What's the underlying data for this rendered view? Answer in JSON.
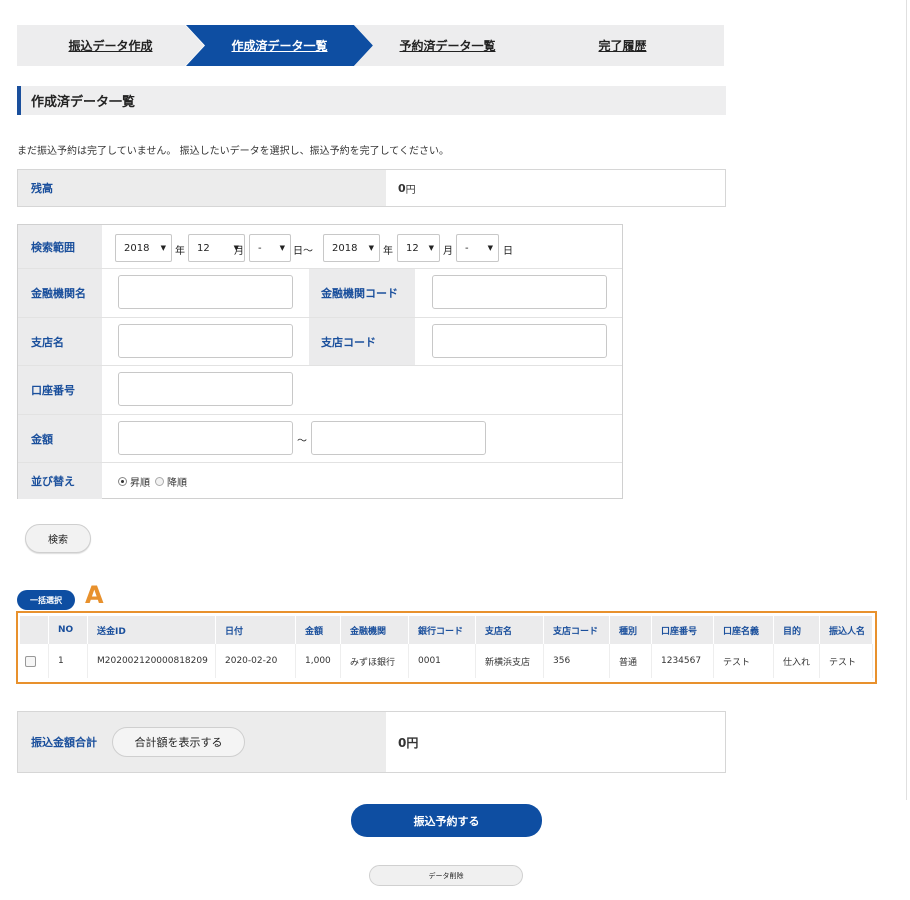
{
  "steps": [
    {
      "label": "振込データ作成",
      "active": false
    },
    {
      "label": "作成済データ一覧",
      "active": true
    },
    {
      "label": "予約済データ一覧",
      "active": false
    },
    {
      "label": "完了履歴",
      "active": false
    }
  ],
  "colors": {
    "primary": "#0e4ea2",
    "highlight": "#e8912d",
    "label_bg": "#ececec"
  },
  "section_title": "作成済データ一覧",
  "notice": "まだ振込予約は完了していません。 振込したいデータを選択し、振込予約を完了してください。",
  "balance": {
    "label": "残高",
    "value": "0",
    "unit": "円"
  },
  "search": {
    "range_label": "検索範囲",
    "from": {
      "year": "2018",
      "month": "12",
      "day": "-"
    },
    "to": {
      "year": "2018",
      "month": "12",
      "day": "-"
    },
    "year_unit": "年",
    "month_unit": "月",
    "day_unit": "日",
    "range_sep": "日～",
    "bank_name_label": "金融機関名",
    "bank_code_label": "金融機関コード",
    "branch_name_label": "支店名",
    "branch_code_label": "支店コード",
    "account_label": "口座番号",
    "amount_label": "金額",
    "amount_sep": "～",
    "sort_label": "並び替え",
    "sort_asc": "昇順",
    "sort_desc": "降順",
    "sort_selected": "asc",
    "search_button": "検索"
  },
  "bulk_select": "一括選択",
  "marker": "A",
  "table": {
    "headers": [
      "",
      "NO",
      "送金ID",
      "日付",
      "金額",
      "金融機関",
      "銀行コード",
      "支店名",
      "支店コード",
      "種別",
      "口座番号",
      "口座名義",
      "目的",
      "振込人名"
    ],
    "rows": [
      [
        "",
        "1",
        "M202002120000818209",
        "2020-02-20",
        "1,000",
        "みずほ銀行",
        "0001",
        "新横浜支店",
        "356",
        "普通",
        "1234567",
        "テスト",
        "仕入れ",
        "テスト"
      ]
    ]
  },
  "total": {
    "label": "振込金額合計",
    "button": "合計額を表示する",
    "value": "0円"
  },
  "reserve_button": "振込予約する",
  "delete_button": "データ削除"
}
